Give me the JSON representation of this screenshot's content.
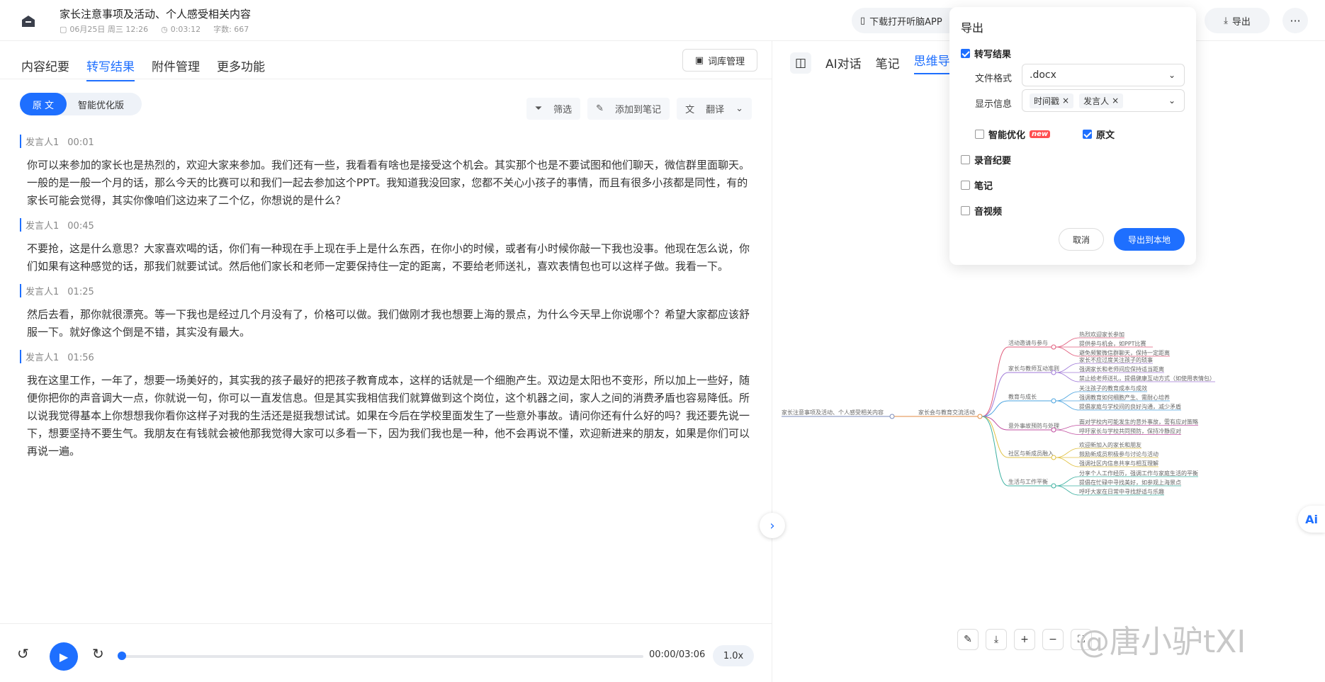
{
  "header": {
    "title": "家长注意事项及活动、个人感受相关内容",
    "date": "06月25日 周三 12:26",
    "duration": "0:03:12",
    "word_count": "字数: 667",
    "download_app": "下载打开听脑APP",
    "export_label": "导出",
    "more_label": "···"
  },
  "left_tabs": [
    "内容纪要",
    "转写结果",
    "附件管理",
    "更多功能"
  ],
  "lexicon_button": "词库管理",
  "view_toggle": {
    "original": "原 文",
    "optimized": "智能优化版"
  },
  "tools": {
    "filter": "筛选",
    "add_note": "添加到笔记",
    "translate": "翻译"
  },
  "transcript": [
    {
      "speaker": "发言人1",
      "time": "00:01",
      "text": "你可以来参加的家长也是热烈的，欢迎大家来参加。我们还有一些，我看看有啥也是接受这个机会。其实那个也是不要试图和他们聊天，微信群里面聊天。一般的是一般一个月的话，那么今天的比赛可以和我们一起去参加这个PPT。我知道我没回家，您都不关心小孩子的事情，而且有很多小孩都是同性，有的家长可能会觉得，其实你像咱们这边来了二个亿，你想说的是什么？"
    },
    {
      "speaker": "发言人1",
      "time": "00:45",
      "text": "不要抢，这是什么意思？大家喜欢喝的话，你们有一种现在手上现在手上是什么东西，在你小的时候，或者有小时候你敲一下我也没事。他现在怎么说，你们如果有这种感觉的话，那我们就要试试。然后他们家长和老师一定要保持住一定的距离，不要给老师送礼，喜欢表情包也可以这样子做。我看一下。"
    },
    {
      "speaker": "发言人1",
      "time": "01:25",
      "text": "然后去看，那你就很漂亮。等一下我也是经过几个月没有了，价格可以做。我们做刚才我也想要上海的景点，为什么今天早上你说哪个？希望大家都应该舒服一下。就好像这个倒是不错，其实没有最大。"
    },
    {
      "speaker": "发言人1",
      "time": "01:56",
      "text": "我在这里工作，一年了，想要一场美好的，其实我的孩子最好的把孩子教育成本，这样的话就是一个细胞产生。双边是太阳也不变形，所以加上一些好，随便你把你的声音调大一点，你就说一句，你可以一直发信息。但是其实我相信我们就算做到这个岗位，这个机器之间，家人之间的消费矛盾也容易降低。所以说我觉得基本上你想想我你看你这样子对我的生活还是挺我想试试。如果在今后在学校里面发生了一些意外事故。请问你还有什么好的吗？我还要先说一下，想要坚持不要生气。我朋友在有钱就会被他那我觉得大家可以多看一下，因为我们我也是一种，他不会再说不懂，欢迎新进来的朋友，如果是你们可以再说一遍。"
    }
  ],
  "player": {
    "time": "00:00/03:06",
    "speed": "1.0x",
    "progress": 0.0
  },
  "right_tabs": [
    "AI对话",
    "笔记",
    "思维导"
  ],
  "export_dialog": {
    "title": "导出",
    "transcript_label": "转写结果",
    "format_label": "文件格式",
    "format_value": ".docx",
    "display_label": "显示信息",
    "display_tags": [
      "时间戳",
      "发言人"
    ],
    "smart_label": "智能优化",
    "new_badge": "new",
    "original_label": "原文",
    "summary_label": "录音纪要",
    "notes_label": "笔记",
    "av_label": "音视频",
    "cancel": "取消",
    "confirm": "导出到本地"
  },
  "mindmap": {
    "root": "家长注意事项及活动、个人感受相关内容",
    "center": "家长会与教育交流活动",
    "branches": [
      {
        "label": "活动邀请与参与",
        "leaves": [
          "热烈欢迎家长参加",
          "提供参与机会，如PPT比赛",
          "避免频繁微信群聊天，保持一定距离"
        ]
      },
      {
        "label": "家长与教师互动准则",
        "leaves": [
          "家长不应过度关注孩子的琐事",
          "强调家长和老师间应保持适当距离",
          "禁止给老师送礼，提倡健康互动方式（如使用表情包）"
        ]
      },
      {
        "label": "教育与成长",
        "leaves": [
          "关注孩子的教育成本与成效",
          "强调教育如何细胞产生、需耐心培养",
          "提倡家庭与学校间的良好沟通，减少矛盾"
        ]
      },
      {
        "label": "意外事故预防与处理",
        "leaves": [
          "面对学校内可能发生的意外事故，需有应对策略",
          "呼吁家长与学校共同预防，保持冷静应对"
        ]
      },
      {
        "label": "社区与新成员融入",
        "leaves": [
          "欢迎新加入的家长和朋友",
          "鼓励新成员积极参与讨论与活动",
          "强调社区内信息共享与相互理解"
        ]
      },
      {
        "label": "生活与工作平衡",
        "leaves": [
          "分享个人工作经历，强调工作与家庭生活的平衡",
          "提倡在忙碌中寻找美好，如参观上海景点",
          "呼吁大家在日常中寻找舒适与乐趣"
        ]
      }
    ]
  },
  "watermark": "@唐小驴tXI",
  "ai_label": "Ai"
}
